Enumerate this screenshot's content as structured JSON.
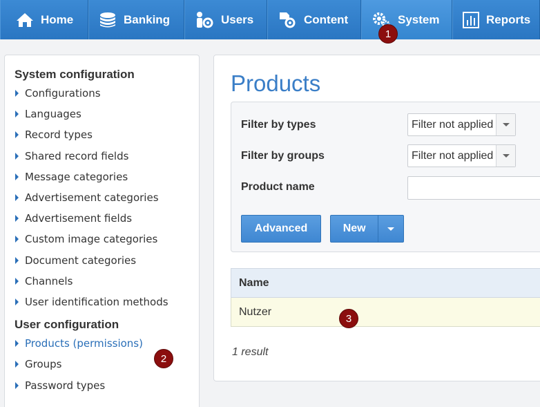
{
  "nav": {
    "tabs": [
      {
        "label": "Home",
        "icon": "home-icon"
      },
      {
        "label": "Banking",
        "icon": "coins-icon"
      },
      {
        "label": "Users",
        "icon": "users-gear-icon"
      },
      {
        "label": "Content",
        "icon": "content-gear-icon"
      },
      {
        "label": "System",
        "icon": "gears-icon",
        "active": true
      },
      {
        "label": "Reports",
        "icon": "bar-chart-icon"
      }
    ]
  },
  "markers": [
    "1",
    "2",
    "3"
  ],
  "sidebar": {
    "system_heading": "System configuration",
    "system_items": [
      "Configurations",
      "Languages",
      "Record types",
      "Shared record fields",
      "Message categories",
      "Advertisement categories",
      "Advertisement fields",
      "Custom image categories",
      "Document categories",
      "Channels",
      "User identification methods"
    ],
    "user_heading": "User configuration",
    "user_items": [
      "Products (permissions)",
      "Groups",
      "Password types"
    ]
  },
  "main": {
    "title": "Products",
    "filters": {
      "types_label": "Filter by types",
      "types_value": "Filter not applied",
      "groups_label": "Filter by groups",
      "groups_value": "Filter not applied",
      "name_label": "Product name",
      "name_value": ""
    },
    "buttons": {
      "advanced": "Advanced",
      "new": "New"
    },
    "table": {
      "header": "Name",
      "rows": [
        "Nutzer"
      ]
    },
    "result_count": "1 result"
  },
  "colors": {
    "nav_blue": "#2f7fcb",
    "title_blue": "#3a7ec7",
    "badge_red": "#8b0e0e",
    "row_highlight": "#fbfbe5"
  }
}
